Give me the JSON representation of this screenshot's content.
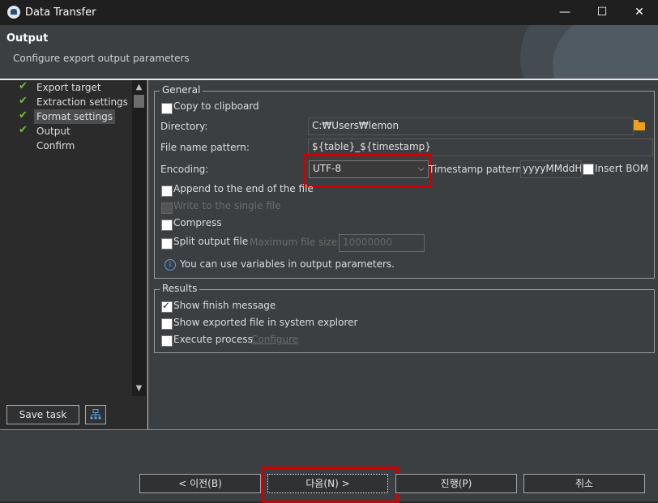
{
  "window": {
    "title": "Data Transfer",
    "minimize": "—",
    "maximize": "☐",
    "close": "✕"
  },
  "header": {
    "title": "Output",
    "subtitle": "Configure export output parameters"
  },
  "steps": [
    {
      "label": "Export target",
      "done": true,
      "selected": false
    },
    {
      "label": "Extraction settings",
      "done": true,
      "selected": false
    },
    {
      "label": "Format settings",
      "done": true,
      "selected": true
    },
    {
      "label": "Output",
      "done": true,
      "selected": false
    },
    {
      "label": "Confirm",
      "done": false,
      "selected": false
    }
  ],
  "left_buttons": {
    "save_task": "Save task"
  },
  "general": {
    "legend": "General",
    "copy_to_clipboard": "Copy to clipboard",
    "directory_label": "Directory:",
    "directory_value": "C:₩Users₩lemon",
    "file_name_pattern_label": "File name pattern:",
    "file_name_pattern_value": "${table}_${timestamp}",
    "encoding_label": "Encoding:",
    "encoding_value": "UTF-8",
    "timestamp_pattern_label": "Timestamp pattern:",
    "timestamp_pattern_value": "yyyyMMddH",
    "insert_bom": "Insert BOM",
    "append": "Append to the end of the file",
    "write_single": "Write to the single file",
    "compress": "Compress",
    "split_output": "Split output file",
    "max_file_size_label": "Maximum file size:",
    "max_file_size_value": "10000000",
    "info": "You can use variables in output parameters."
  },
  "results": {
    "legend": "Results",
    "show_finish": "Show finish message",
    "show_exported": "Show exported file in system explorer",
    "execute_process": "Execute process",
    "configure": "Configure"
  },
  "footer": {
    "back": "< 이전(B)",
    "next": "다음(N) >",
    "proceed": "진행(P)",
    "cancel": "취소"
  },
  "colors": {
    "highlight": "#d10000",
    "check": "#6fbf40",
    "folder": "#f0a020",
    "info": "#5aa0e0"
  }
}
